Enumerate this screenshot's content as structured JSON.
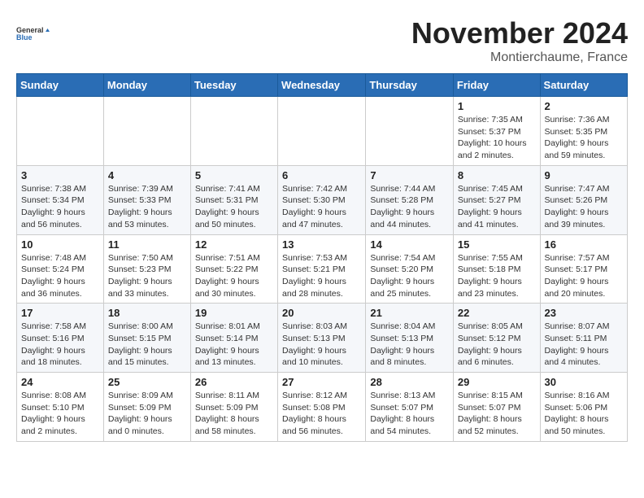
{
  "logo": {
    "line1": "General",
    "line2": "Blue"
  },
  "title": "November 2024",
  "location": "Montierchaume, France",
  "header": {
    "days": [
      "Sunday",
      "Monday",
      "Tuesday",
      "Wednesday",
      "Thursday",
      "Friday",
      "Saturday"
    ]
  },
  "weeks": [
    {
      "cells": [
        {
          "day": null,
          "content": null
        },
        {
          "day": null,
          "content": null
        },
        {
          "day": null,
          "content": null
        },
        {
          "day": null,
          "content": null
        },
        {
          "day": null,
          "content": null
        },
        {
          "day": "1",
          "sunrise": "Sunrise: 7:35 AM",
          "sunset": "Sunset: 5:37 PM",
          "daylight": "Daylight: 10 hours and 2 minutes."
        },
        {
          "day": "2",
          "sunrise": "Sunrise: 7:36 AM",
          "sunset": "Sunset: 5:35 PM",
          "daylight": "Daylight: 9 hours and 59 minutes."
        }
      ]
    },
    {
      "cells": [
        {
          "day": "3",
          "sunrise": "Sunrise: 7:38 AM",
          "sunset": "Sunset: 5:34 PM",
          "daylight": "Daylight: 9 hours and 56 minutes."
        },
        {
          "day": "4",
          "sunrise": "Sunrise: 7:39 AM",
          "sunset": "Sunset: 5:33 PM",
          "daylight": "Daylight: 9 hours and 53 minutes."
        },
        {
          "day": "5",
          "sunrise": "Sunrise: 7:41 AM",
          "sunset": "Sunset: 5:31 PM",
          "daylight": "Daylight: 9 hours and 50 minutes."
        },
        {
          "day": "6",
          "sunrise": "Sunrise: 7:42 AM",
          "sunset": "Sunset: 5:30 PM",
          "daylight": "Daylight: 9 hours and 47 minutes."
        },
        {
          "day": "7",
          "sunrise": "Sunrise: 7:44 AM",
          "sunset": "Sunset: 5:28 PM",
          "daylight": "Daylight: 9 hours and 44 minutes."
        },
        {
          "day": "8",
          "sunrise": "Sunrise: 7:45 AM",
          "sunset": "Sunset: 5:27 PM",
          "daylight": "Daylight: 9 hours and 41 minutes."
        },
        {
          "day": "9",
          "sunrise": "Sunrise: 7:47 AM",
          "sunset": "Sunset: 5:26 PM",
          "daylight": "Daylight: 9 hours and 39 minutes."
        }
      ]
    },
    {
      "cells": [
        {
          "day": "10",
          "sunrise": "Sunrise: 7:48 AM",
          "sunset": "Sunset: 5:24 PM",
          "daylight": "Daylight: 9 hours and 36 minutes."
        },
        {
          "day": "11",
          "sunrise": "Sunrise: 7:50 AM",
          "sunset": "Sunset: 5:23 PM",
          "daylight": "Daylight: 9 hours and 33 minutes."
        },
        {
          "day": "12",
          "sunrise": "Sunrise: 7:51 AM",
          "sunset": "Sunset: 5:22 PM",
          "daylight": "Daylight: 9 hours and 30 minutes."
        },
        {
          "day": "13",
          "sunrise": "Sunrise: 7:53 AM",
          "sunset": "Sunset: 5:21 PM",
          "daylight": "Daylight: 9 hours and 28 minutes."
        },
        {
          "day": "14",
          "sunrise": "Sunrise: 7:54 AM",
          "sunset": "Sunset: 5:20 PM",
          "daylight": "Daylight: 9 hours and 25 minutes."
        },
        {
          "day": "15",
          "sunrise": "Sunrise: 7:55 AM",
          "sunset": "Sunset: 5:18 PM",
          "daylight": "Daylight: 9 hours and 23 minutes."
        },
        {
          "day": "16",
          "sunrise": "Sunrise: 7:57 AM",
          "sunset": "Sunset: 5:17 PM",
          "daylight": "Daylight: 9 hours and 20 minutes."
        }
      ]
    },
    {
      "cells": [
        {
          "day": "17",
          "sunrise": "Sunrise: 7:58 AM",
          "sunset": "Sunset: 5:16 PM",
          "daylight": "Daylight: 9 hours and 18 minutes."
        },
        {
          "day": "18",
          "sunrise": "Sunrise: 8:00 AM",
          "sunset": "Sunset: 5:15 PM",
          "daylight": "Daylight: 9 hours and 15 minutes."
        },
        {
          "day": "19",
          "sunrise": "Sunrise: 8:01 AM",
          "sunset": "Sunset: 5:14 PM",
          "daylight": "Daylight: 9 hours and 13 minutes."
        },
        {
          "day": "20",
          "sunrise": "Sunrise: 8:03 AM",
          "sunset": "Sunset: 5:13 PM",
          "daylight": "Daylight: 9 hours and 10 minutes."
        },
        {
          "day": "21",
          "sunrise": "Sunrise: 8:04 AM",
          "sunset": "Sunset: 5:13 PM",
          "daylight": "Daylight: 9 hours and 8 minutes."
        },
        {
          "day": "22",
          "sunrise": "Sunrise: 8:05 AM",
          "sunset": "Sunset: 5:12 PM",
          "daylight": "Daylight: 9 hours and 6 minutes."
        },
        {
          "day": "23",
          "sunrise": "Sunrise: 8:07 AM",
          "sunset": "Sunset: 5:11 PM",
          "daylight": "Daylight: 9 hours and 4 minutes."
        }
      ]
    },
    {
      "cells": [
        {
          "day": "24",
          "sunrise": "Sunrise: 8:08 AM",
          "sunset": "Sunset: 5:10 PM",
          "daylight": "Daylight: 9 hours and 2 minutes."
        },
        {
          "day": "25",
          "sunrise": "Sunrise: 8:09 AM",
          "sunset": "Sunset: 5:09 PM",
          "daylight": "Daylight: 9 hours and 0 minutes."
        },
        {
          "day": "26",
          "sunrise": "Sunrise: 8:11 AM",
          "sunset": "Sunset: 5:09 PM",
          "daylight": "Daylight: 8 hours and 58 minutes."
        },
        {
          "day": "27",
          "sunrise": "Sunrise: 8:12 AM",
          "sunset": "Sunset: 5:08 PM",
          "daylight": "Daylight: 8 hours and 56 minutes."
        },
        {
          "day": "28",
          "sunrise": "Sunrise: 8:13 AM",
          "sunset": "Sunset: 5:07 PM",
          "daylight": "Daylight: 8 hours and 54 minutes."
        },
        {
          "day": "29",
          "sunrise": "Sunrise: 8:15 AM",
          "sunset": "Sunset: 5:07 PM",
          "daylight": "Daylight: 8 hours and 52 minutes."
        },
        {
          "day": "30",
          "sunrise": "Sunrise: 8:16 AM",
          "sunset": "Sunset: 5:06 PM",
          "daylight": "Daylight: 8 hours and 50 minutes."
        }
      ]
    }
  ]
}
